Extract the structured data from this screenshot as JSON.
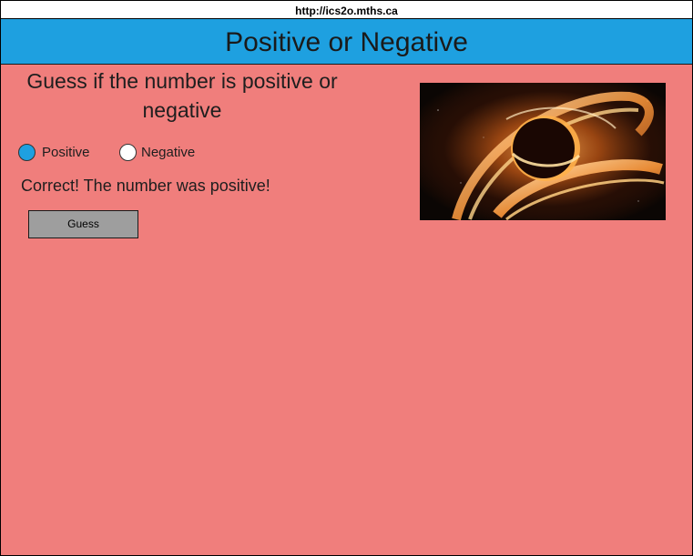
{
  "browser": {
    "url": "http://ics2o.mths.ca"
  },
  "header": {
    "title": "Positive or Negative"
  },
  "main": {
    "question": "Guess if the number is positive or negative",
    "options": [
      {
        "label": "Positive",
        "checked": true
      },
      {
        "label": "Negative",
        "checked": false
      }
    ],
    "result": "Correct! The number was positive!",
    "button_label": "Guess",
    "image_icon": "black-hole-image"
  },
  "colors": {
    "background": "#f07e7c",
    "header": "#1ea0e0",
    "selected_radio": "#1ea0e0",
    "button": "#9e9e9e"
  }
}
